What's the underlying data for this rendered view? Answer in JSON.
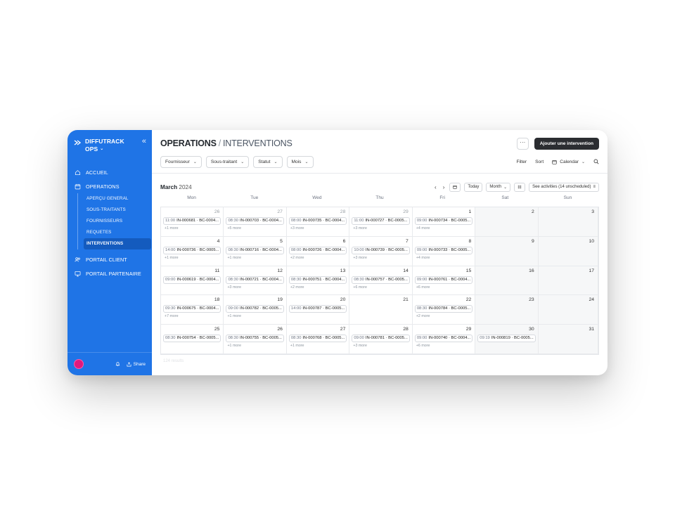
{
  "brand": {
    "name": "DIFFUTRACK",
    "sub": "OPS"
  },
  "sidebar": {
    "items": [
      {
        "label": "ACCUEIL"
      },
      {
        "label": "OPERATIONS"
      },
      {
        "label": "PORTAIL CLIENT"
      },
      {
        "label": "PORTAIL PARTENAIRE"
      }
    ],
    "operations_sub": [
      {
        "label": "APERÇU GENERAL"
      },
      {
        "label": "SOUS-TRAITANTS"
      },
      {
        "label": "FOURNISSEURS"
      },
      {
        "label": "REQUETES"
      },
      {
        "label": "INTERVENTIONS"
      }
    ],
    "share_label": "Share"
  },
  "header": {
    "section": "OPERATIONS",
    "separator": "/",
    "page": "INTERVENTIONS",
    "more_label": "···",
    "primary_action": "Ajouter une intervention"
  },
  "filters": {
    "buttons": [
      "Fournisseur",
      "Sous-traitant",
      "Statut",
      "Mois"
    ],
    "filter_label": "Filter",
    "sort_label": "Sort",
    "view_label": "Calendar"
  },
  "calendar": {
    "month": "March",
    "year": "2024",
    "today_label": "Today",
    "view_mode": "Month",
    "activities_label": "See activities (14 unscheduled)",
    "days_of_week": [
      "Mon",
      "Tue",
      "Wed",
      "Thu",
      "Fri",
      "Sat",
      "Sun"
    ],
    "weeks": [
      [
        {
          "day": "26",
          "prev": true,
          "ev": {
            "time": "11:00",
            "title": "IN-000681 · BC-0004..."
          },
          "more": "+1 more"
        },
        {
          "day": "27",
          "prev": true,
          "ev": {
            "time": "08:30",
            "title": "IN-000703 · BC-0004..."
          },
          "more": "+5 more"
        },
        {
          "day": "28",
          "prev": true,
          "ev": {
            "time": "08:00",
            "title": "IN-000735 · BC-0004..."
          },
          "more": "+3 more"
        },
        {
          "day": "29",
          "prev": true,
          "ev": {
            "time": "11:00",
            "title": "IN-000727 · BC-0005..."
          },
          "more": "+3 more"
        },
        {
          "day": "1",
          "ev": {
            "time": "09:00",
            "title": "IN-000734 · BC-0005..."
          },
          "more": "+4 more"
        },
        {
          "day": "2",
          "weekend": true
        },
        {
          "day": "3",
          "weekend": true
        }
      ],
      [
        {
          "day": "4",
          "ev": {
            "time": "14:00",
            "title": "IN-000736 · BC-0005..."
          },
          "more": "+1 more"
        },
        {
          "day": "5",
          "ev": {
            "time": "08:30",
            "title": "IN-000716 · BC-0004..."
          },
          "more": "+1 more"
        },
        {
          "day": "6",
          "ev": {
            "time": "08:00",
            "title": "IN-000726 · BC-0004..."
          },
          "more": "+2 more"
        },
        {
          "day": "7",
          "ev": {
            "time": "10:00",
            "title": "IN-000739 · BC-0005..."
          },
          "more": "+3 more"
        },
        {
          "day": "8",
          "ev": {
            "time": "09:00",
            "title": "IN-000733 · BC-0005..."
          },
          "more": "+4 more"
        },
        {
          "day": "9",
          "weekend": true
        },
        {
          "day": "10",
          "weekend": true
        }
      ],
      [
        {
          "day": "11",
          "ev": {
            "time": "09:00",
            "title": "IN-000619 · BC-0004..."
          }
        },
        {
          "day": "12",
          "ev": {
            "time": "08:30",
            "title": "IN-000721 · BC-0004..."
          },
          "more": "+3 more"
        },
        {
          "day": "13",
          "ev": {
            "time": "08:30",
            "title": "IN-000751 · BC-0004..."
          },
          "more": "+2 more"
        },
        {
          "day": "14",
          "ev": {
            "time": "08:30",
            "title": "IN-000757 · BC-0005..."
          },
          "more": "+6 more"
        },
        {
          "day": "15",
          "ev": {
            "time": "09:00",
            "title": "IN-000761 · BC-0004..."
          },
          "more": "+6 more"
        },
        {
          "day": "16",
          "weekend": true
        },
        {
          "day": "17",
          "weekend": true
        }
      ],
      [
        {
          "day": "18",
          "ev": {
            "time": "09:30",
            "title": "IN-000675 · BC-0004..."
          },
          "more": "+7 more"
        },
        {
          "day": "19",
          "ev": {
            "time": "09:00",
            "title": "IN-000782 · BC-0005..."
          },
          "more": "+1 more"
        },
        {
          "day": "20",
          "ev": {
            "time": "14:00",
            "title": "IN-000787 · BC-0005..."
          }
        },
        {
          "day": "21"
        },
        {
          "day": "22",
          "ev": {
            "time": "08:30",
            "title": "IN-000784 · BC-0005..."
          },
          "more": "+2 more"
        },
        {
          "day": "23",
          "weekend": true
        },
        {
          "day": "24",
          "weekend": true
        }
      ],
      [
        {
          "day": "25",
          "ev": {
            "time": "08:30",
            "title": "IN-000754 · BC-0005..."
          }
        },
        {
          "day": "26",
          "ev": {
            "time": "08:30",
            "title": "IN-000755 · BC-0005..."
          },
          "more": "+1 more"
        },
        {
          "day": "27",
          "ev": {
            "time": "08:30",
            "title": "IN-000768 · BC-0005..."
          },
          "more": "+1 more"
        },
        {
          "day": "28",
          "ev": {
            "time": "09:00",
            "title": "IN-000781 · BC-0005..."
          },
          "more": "+3 more"
        },
        {
          "day": "29",
          "ev": {
            "time": "09:00",
            "title": "IN-000740 · BC-0004..."
          },
          "more": "+6 more"
        },
        {
          "day": "30",
          "weekend": true,
          "ev": {
            "time": "09:19",
            "title": "IN-000819 · BC-0005..."
          }
        },
        {
          "day": "31",
          "weekend": true
        }
      ]
    ],
    "footer_note": "124 results"
  },
  "colors": {
    "sidebar": "#1f74e6",
    "primary_button": "#2b2d31",
    "avatar": "#e0197d"
  }
}
